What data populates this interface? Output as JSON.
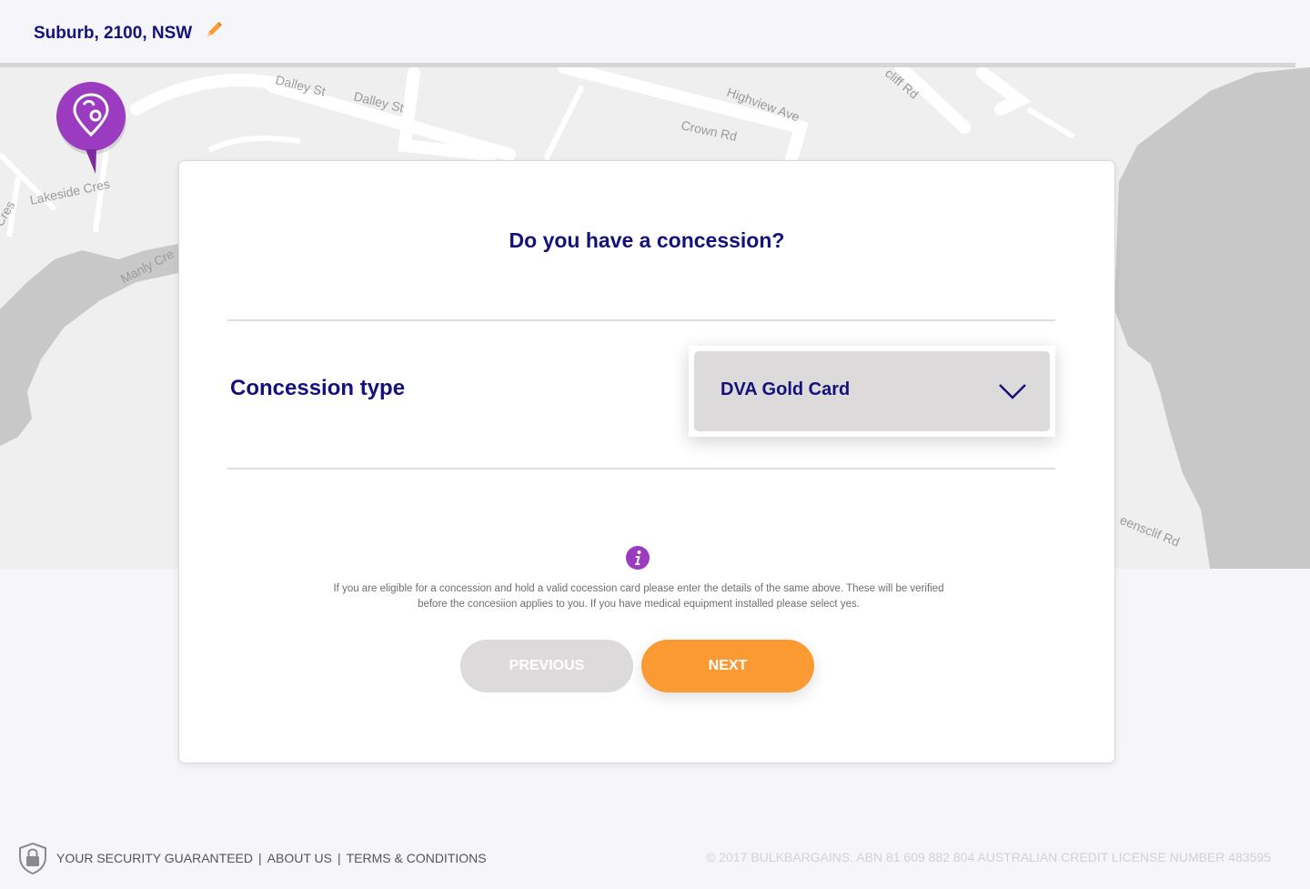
{
  "header": {
    "location": "Suburb, 2100, NSW",
    "edit_icon": "pencil-icon"
  },
  "map": {
    "street_labels": [
      "Dalley St",
      "Dalley St",
      "Highview Ave",
      "Crown Rd",
      "Lakeside Cres",
      "Manly Cre",
      "cliff Rd",
      "Cres",
      "eensclif Rd"
    ],
    "pin_icon": "location-pin-icon"
  },
  "card": {
    "question": "Do you have a concession?",
    "field_label": "Concession type",
    "select_value": "DVA Gold Card",
    "info_icon": "info-icon",
    "info_text": "If you are eligible for a concession and hold a valid cocession card please enter the details of the same above. These will be verified before the concesiion applies to you. If you have medical equipment installed please select yes.",
    "previous_label": "PREVIOUS",
    "next_label": "NEXT"
  },
  "footer": {
    "security": "YOUR SECURITY GUARANTEED",
    "about": "ABOUT US",
    "terms": "TERMS & CONDITIONS",
    "separator": "|",
    "copyright": "© 2017 BULKBARGAINS. ABN 81 609 882 804 AUSTRALIAN CREDIT LICENSE NUMBER 483595"
  },
  "colors": {
    "brand_navy": "#14127a",
    "accent_orange": "#fb9933",
    "pin_purple": "#9a3bc0",
    "disabled_gray": "#dcdadb"
  }
}
